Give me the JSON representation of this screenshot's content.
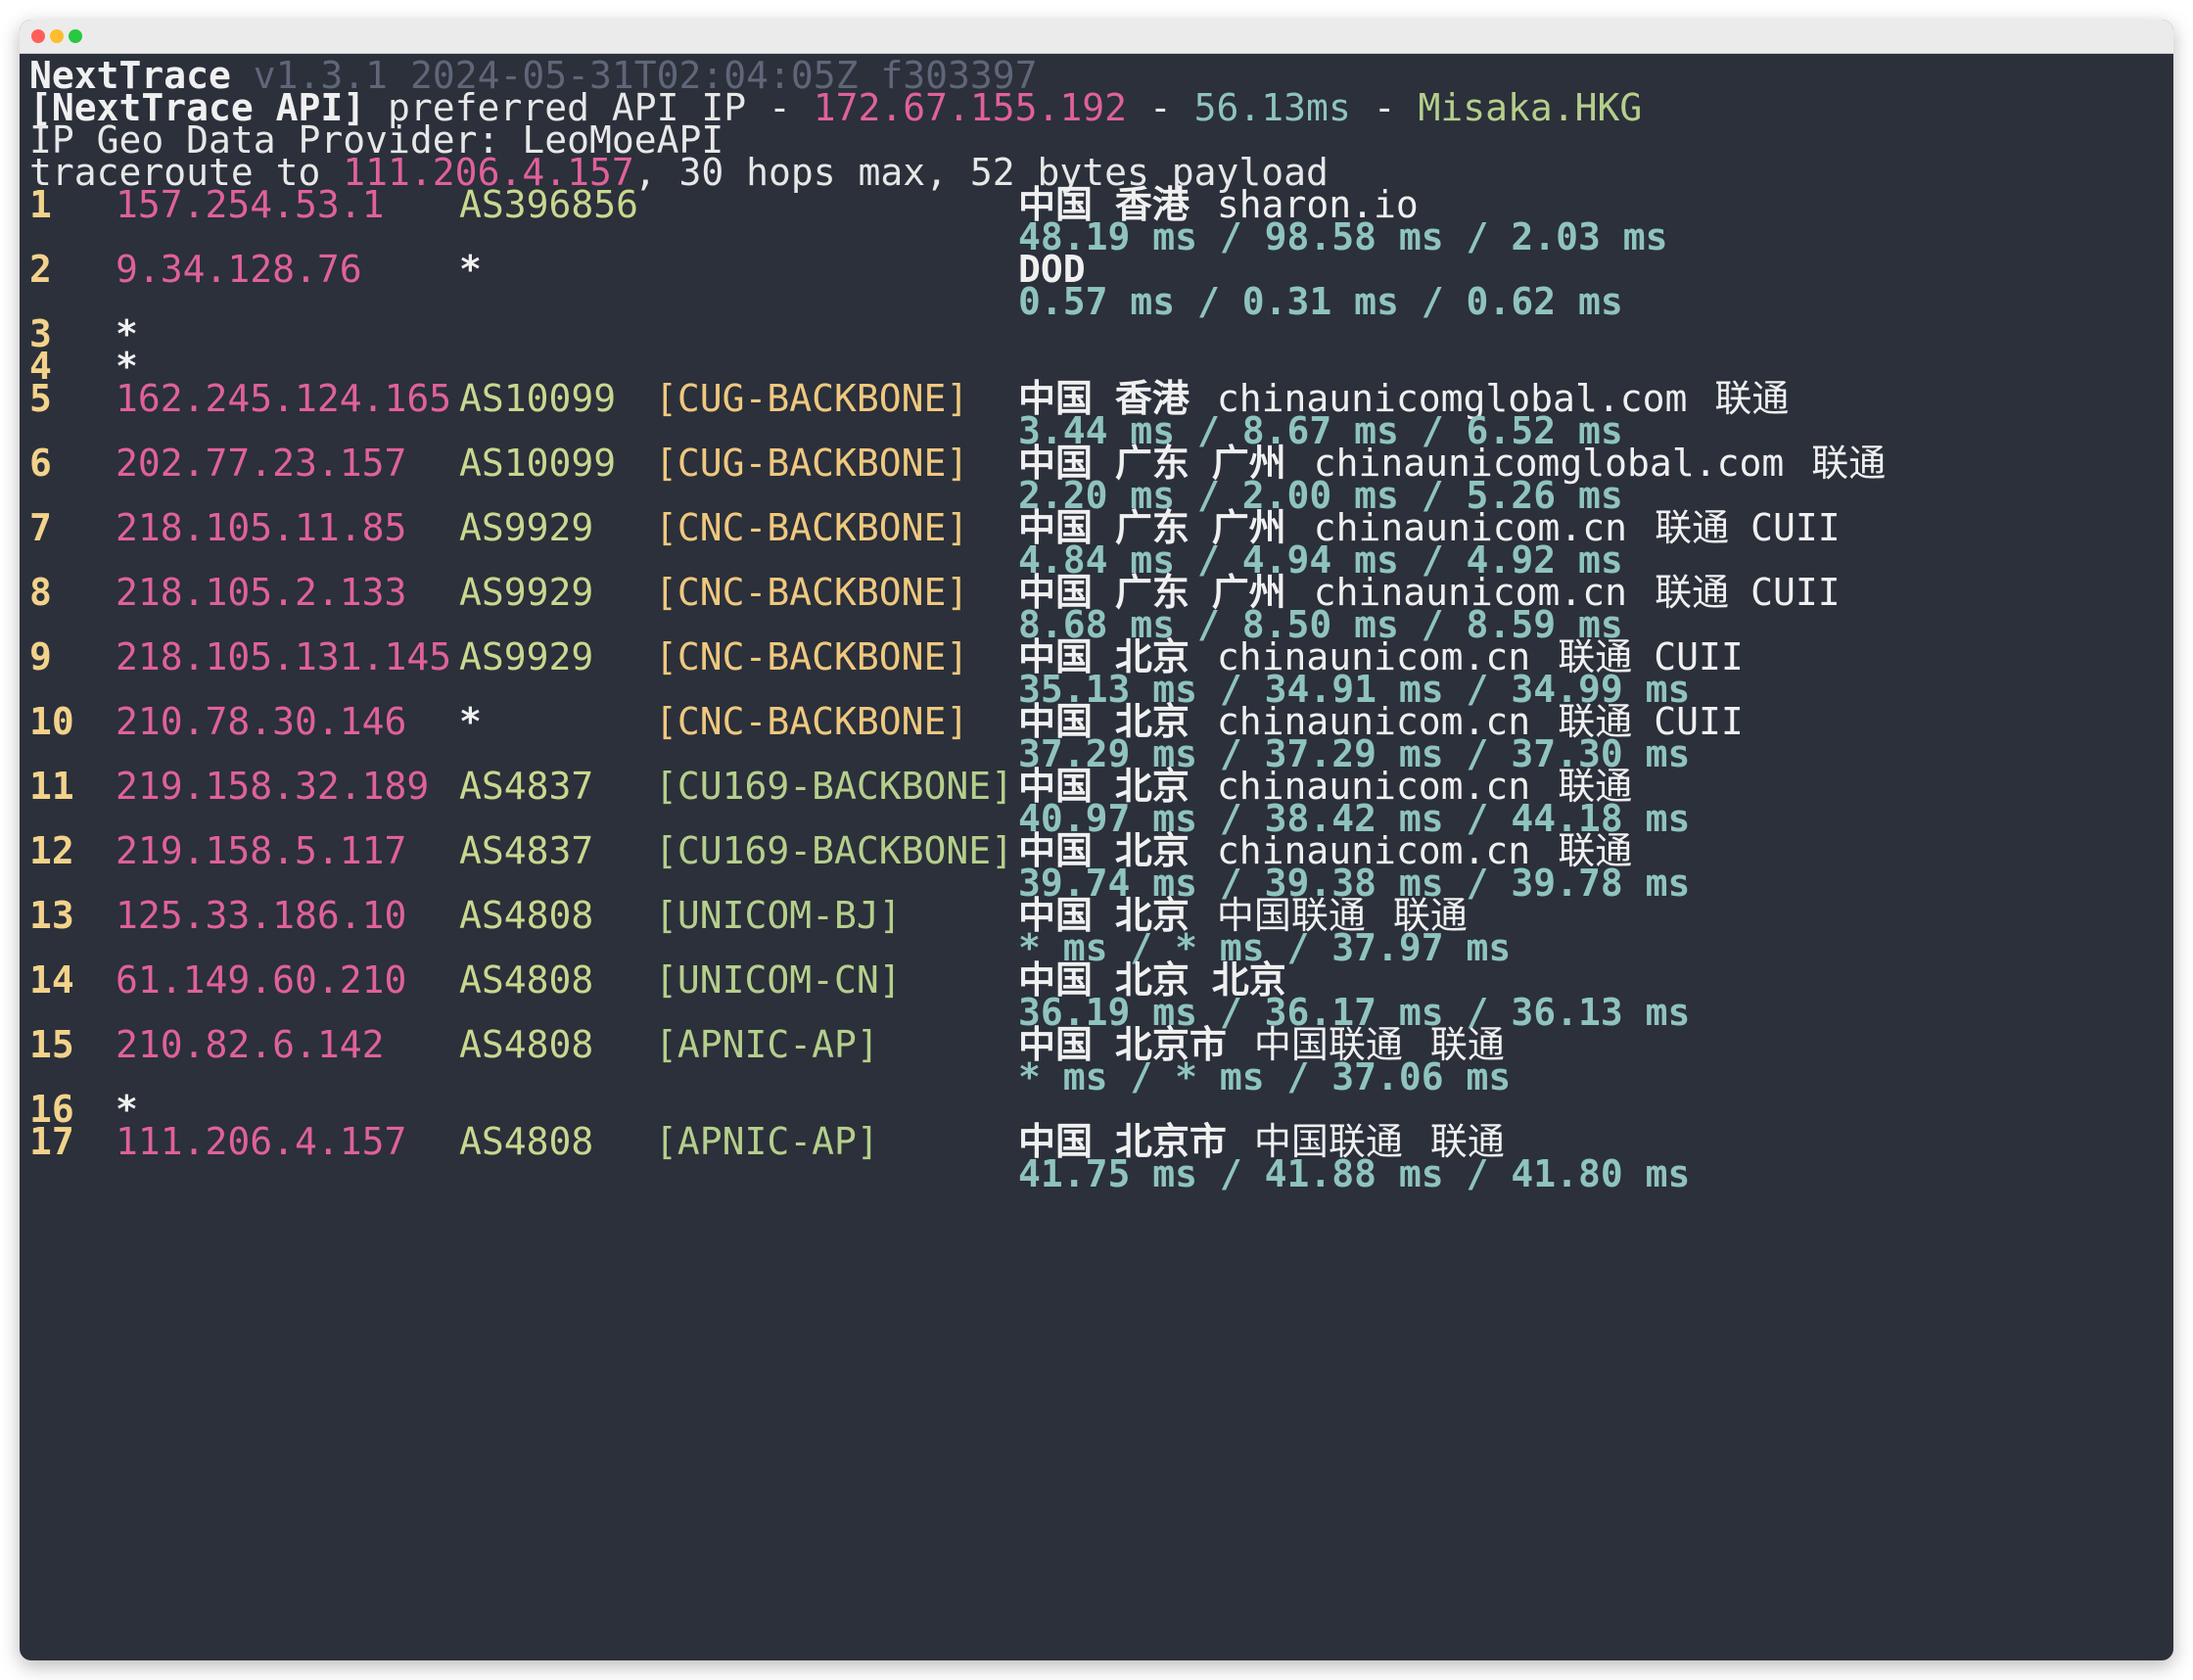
{
  "window": {
    "controls": [
      "close",
      "minimize",
      "zoom"
    ]
  },
  "header": {
    "app_name": "NextTrace",
    "version": "v1.3.1 2024-05-31T02:04:05Z f303397",
    "api_label": "[NextTrace API]",
    "api_text": " preferred API IP - ",
    "api_ip": "172.67.155.192",
    "api_sep1": " - ",
    "api_latency": "56.13ms",
    "api_sep2": " - ",
    "api_node": "Misaka.HKG",
    "geo_provider": "IP Geo Data Provider: LeoMoeAPI",
    "trace_prefix": "traceroute to ",
    "trace_target": "111.206.4.157",
    "trace_suffix": ", 30 hops max, 52 bytes payload"
  },
  "hops": [
    {
      "n": "1",
      "ip": "157.254.53.1",
      "asn": "AS396856",
      "net": "",
      "loc": "中国 香港",
      "domain": "sharon.io",
      "isp": "",
      "tag": "",
      "times": "48.19 ms / 98.58 ms / 2.03 ms"
    },
    {
      "n": "2",
      "ip": "9.34.128.76",
      "asn": "*",
      "net": "",
      "loc": "DOD",
      "domain": "",
      "isp": "",
      "tag": "",
      "times": "0.57 ms / 0.31 ms / 0.62 ms"
    },
    {
      "n": "3",
      "ip": "*"
    },
    {
      "n": "4",
      "ip": "*"
    },
    {
      "n": "5",
      "ip": "162.245.124.165",
      "asn": "AS10099",
      "net": "[CUG-BACKBONE]",
      "loc": "中国 香港",
      "domain": "chinaunicomglobal.com",
      "isp": "联通",
      "tag": "",
      "times": "3.44 ms / 8.67 ms / 6.52 ms"
    },
    {
      "n": "6",
      "ip": "202.77.23.157",
      "asn": "AS10099",
      "net": "[CUG-BACKBONE]",
      "loc": "中国 广东 广州",
      "domain": "chinaunicomglobal.com",
      "isp": "联通",
      "tag": "",
      "times": "2.20 ms / 2.00 ms / 5.26 ms"
    },
    {
      "n": "7",
      "ip": "218.105.11.85",
      "asn": "AS9929",
      "net": "[CNC-BACKBONE]",
      "loc": "中国 广东 广州",
      "domain": "chinaunicom.cn",
      "isp": "联通",
      "tag": "CUII",
      "times": "4.84 ms / 4.94 ms / 4.92 ms"
    },
    {
      "n": "8",
      "ip": "218.105.2.133",
      "asn": "AS9929",
      "net": "[CNC-BACKBONE]",
      "loc": "中国 广东 广州",
      "domain": "chinaunicom.cn",
      "isp": "联通",
      "tag": "CUII",
      "times": "8.68 ms / 8.50 ms / 8.59 ms"
    },
    {
      "n": "9",
      "ip": "218.105.131.145",
      "asn": "AS9929",
      "net": "[CNC-BACKBONE]",
      "loc": "中国 北京",
      "domain": "chinaunicom.cn",
      "isp": "联通",
      "tag": "CUII",
      "times": "35.13 ms / 34.91 ms / 34.99 ms"
    },
    {
      "n": "10",
      "ip": "210.78.30.146",
      "asn": "*",
      "net": "[CNC-BACKBONE]",
      "loc": "中国 北京",
      "domain": "chinaunicom.cn",
      "isp": "联通",
      "tag": "CUII",
      "times": "37.29 ms / 37.29 ms / 37.30 ms"
    },
    {
      "n": "11",
      "ip": "219.158.32.189",
      "asn": "AS4837",
      "net": "[CU169-BACKBONE]",
      "loc": "中国 北京",
      "domain": "chinaunicom.cn",
      "isp": "联通",
      "tag": "",
      "times": "40.97 ms / 38.42 ms / 44.18 ms"
    },
    {
      "n": "12",
      "ip": "219.158.5.117",
      "asn": "AS4837",
      "net": "[CU169-BACKBONE]",
      "loc": "中国 北京",
      "domain": "chinaunicom.cn",
      "isp": "联通",
      "tag": "",
      "times": "39.74 ms / 39.38 ms / 39.78 ms"
    },
    {
      "n": "13",
      "ip": "125.33.186.10",
      "asn": "AS4808",
      "net": "[UNICOM-BJ]",
      "loc": "中国 北京",
      "domain": "中国联通",
      "isp": "联通",
      "tag": "",
      "times": "* ms / * ms / 37.97 ms"
    },
    {
      "n": "14",
      "ip": "61.149.60.210",
      "asn": "AS4808",
      "net": "[UNICOM-CN]",
      "loc": "中国 北京 北京",
      "domain": "",
      "isp": "",
      "tag": "",
      "times": "36.19 ms / 36.17 ms / 36.13 ms"
    },
    {
      "n": "15",
      "ip": "210.82.6.142",
      "asn": "AS4808",
      "net": "[APNIC-AP]",
      "loc": "中国 北京市",
      "domain": "中国联通",
      "isp": "联通",
      "tag": "",
      "times": "* ms / * ms / 37.06 ms"
    },
    {
      "n": "16",
      "ip": "*"
    },
    {
      "n": "17",
      "ip": "111.206.4.157",
      "asn": "AS4808",
      "net": "[APNIC-AP]",
      "loc": "中国 北京市",
      "domain": "中国联通",
      "isp": "联通",
      "tag": "",
      "times": "41.75 ms / 41.88 ms / 41.80 ms"
    }
  ],
  "colors": {
    "background": "#2b303b",
    "hop_number": "#f3d28a",
    "ip": "#e0619a",
    "latency": "#8fc3bd",
    "network": "#f0c87e",
    "network_cu169": "#b5cf8b"
  }
}
